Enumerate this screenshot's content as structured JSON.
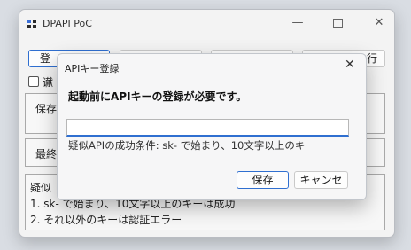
{
  "main_window": {
    "title": "DPAPI PoC",
    "minimize_glyph": "—",
    "close_glyph": "✕",
    "toolbar": {
      "register_label": "登",
      "run_label": "行"
    },
    "option_label": "谳",
    "save_group_label": "保存",
    "latest_label": "最終",
    "info_lines": [
      "疑似",
      "1. sk- で始まり、10文字以上のキーは成功",
      "2. それ以外のキーは認証エラー"
    ]
  },
  "dialog": {
    "title": "APIキー登録",
    "close_glyph": "✕",
    "heading": "起動前にAPIキーの登録が必要です。",
    "api_key_value": "",
    "hint": "疑似APIの成功条件: sk- で始まり、10文字以上のキー",
    "save_label": "保存",
    "cancel_label": "キャンセ"
  },
  "icons": [
    "app-icon",
    "minimize-icon",
    "maximize-icon",
    "close-icon",
    "dialog-close-icon",
    "checkbox"
  ],
  "colors": {
    "accent": "#2f6fd0",
    "window_bg": "#f3f3f3",
    "dialog_bg": "#f6f6f7"
  }
}
